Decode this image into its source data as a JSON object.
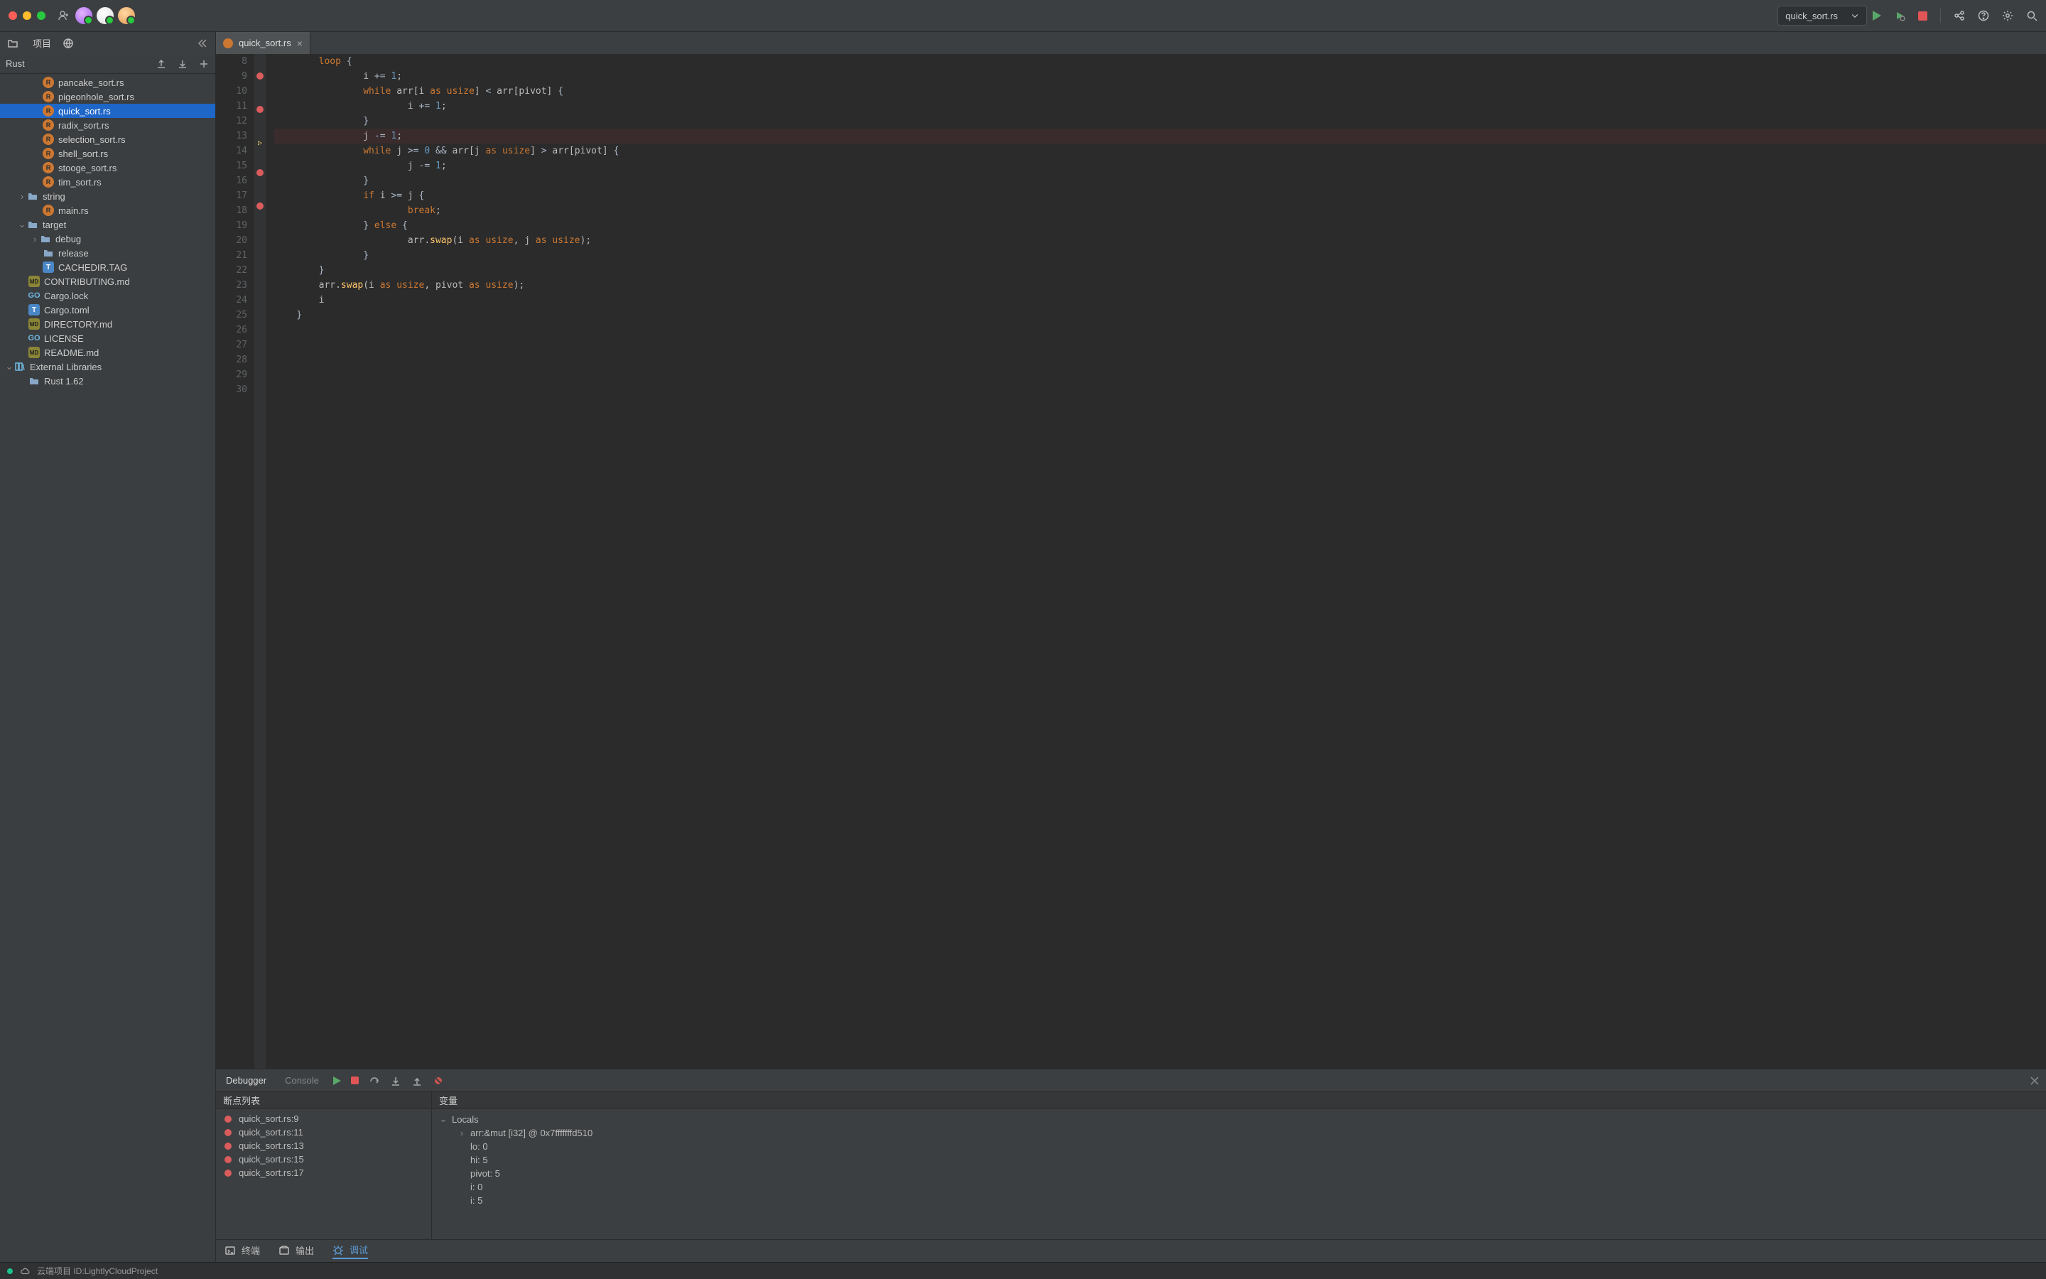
{
  "titlebar": {
    "run_config": "quick_sort.rs"
  },
  "secondbar": {
    "project_label": "项目"
  },
  "sidebar": {
    "root_label": "Rust",
    "items": [
      {
        "indent": 60,
        "icon": "rs",
        "label": "pancake_sort.rs",
        "sel": false
      },
      {
        "indent": 60,
        "icon": "rs",
        "label": "pigeonhole_sort.rs",
        "sel": false
      },
      {
        "indent": 60,
        "icon": "rs",
        "label": "quick_sort.rs",
        "sel": true
      },
      {
        "indent": 60,
        "icon": "rs",
        "label": "radix_sort.rs",
        "sel": false
      },
      {
        "indent": 60,
        "icon": "rs",
        "label": "selection_sort.rs",
        "sel": false
      },
      {
        "indent": 60,
        "icon": "rs",
        "label": "shell_sort.rs",
        "sel": false
      },
      {
        "indent": 60,
        "icon": "rs",
        "label": "stooge_sort.rs",
        "sel": false
      },
      {
        "indent": 60,
        "icon": "rs",
        "label": "tim_sort.rs",
        "sel": false
      },
      {
        "indent": 24,
        "tw": "›",
        "icon": "dir",
        "label": "string",
        "sel": false
      },
      {
        "indent": 60,
        "icon": "rs",
        "label": "main.rs",
        "sel": false
      },
      {
        "indent": 24,
        "tw": "⌄",
        "icon": "dir",
        "label": "target",
        "sel": false
      },
      {
        "indent": 42,
        "tw": "›",
        "icon": "dir",
        "label": "debug",
        "sel": false
      },
      {
        "indent": 60,
        "icon": "dir",
        "label": "release",
        "sel": false
      },
      {
        "indent": 60,
        "icon": "txt",
        "label": "CACHEDIR.TAG",
        "sel": false
      },
      {
        "indent": 40,
        "icon": "md",
        "label": "CONTRIBUTING.md",
        "sel": false
      },
      {
        "indent": 40,
        "icon": "go",
        "label": "Cargo.lock",
        "sel": false
      },
      {
        "indent": 40,
        "icon": "txt",
        "label": "Cargo.toml",
        "sel": false
      },
      {
        "indent": 40,
        "icon": "md",
        "label": "DIRECTORY.md",
        "sel": false
      },
      {
        "indent": 40,
        "icon": "go",
        "label": "LICENSE",
        "sel": false
      },
      {
        "indent": 40,
        "icon": "md",
        "label": "README.md",
        "sel": false
      },
      {
        "indent": 6,
        "tw": "⌄",
        "icon": "lib",
        "label": "External Libraries",
        "sel": false
      },
      {
        "indent": 40,
        "icon": "dir",
        "label": "Rust 1.62",
        "sel": false
      }
    ]
  },
  "editor": {
    "tab_label": "quick_sort.rs",
    "lines": [
      {
        "n": 8,
        "bp": false,
        "cur": false,
        "html": "<span class='k'>loop</span> <span class='br'>{</span>"
      },
      {
        "n": 9,
        "bp": true,
        "cur": false,
        "html": "    i <span class='op'>+=</span> <span class='n'>1</span>;"
      },
      {
        "n": 10,
        "bp": false,
        "cur": false,
        "html": "    <span class='k'>while</span> arr[i <span class='k'>as</span> <span class='k'>usize</span>] <span class='op'>&lt;</span> arr[pivot] <span class='br'>{</span>"
      },
      {
        "n": 11,
        "bp": true,
        "cur": false,
        "html": "        i <span class='op'>+=</span> <span class='n'>1</span>;"
      },
      {
        "n": 12,
        "bp": false,
        "cur": false,
        "html": "    <span class='br'>}</span>"
      },
      {
        "n": 13,
        "bp": false,
        "cur": true,
        "html": "    j <span class='op'>-=</span> <span class='n'>1</span>;"
      },
      {
        "n": 14,
        "bp": false,
        "cur": false,
        "html": "    <span class='k'>while</span> j <span class='op'>&gt;=</span> <span class='n'>0</span> <span class='op'>&amp;&amp;</span> arr[j <span class='k'>as</span> <span class='k'>usize</span>] <span class='op'>&gt;</span> arr[pivot] <span class='br'>{</span>"
      },
      {
        "n": 15,
        "bp": true,
        "cur": false,
        "html": "        j <span class='op'>-=</span> <span class='n'>1</span>;"
      },
      {
        "n": 16,
        "bp": false,
        "cur": false,
        "html": "    <span class='br'>}</span>"
      },
      {
        "n": 17,
        "bp": true,
        "cur": false,
        "html": "    <span class='k'>if</span> i <span class='op'>&gt;=</span> j <span class='br'>{</span>"
      },
      {
        "n": 18,
        "bp": false,
        "cur": false,
        "html": "        <span class='k'>break</span>;"
      },
      {
        "n": 19,
        "bp": false,
        "cur": false,
        "html": "    <span class='br'>}</span> <span class='k'>else</span> <span class='br'>{</span>"
      },
      {
        "n": 20,
        "bp": false,
        "cur": false,
        "html": "        arr.<span class='fnc'>swap</span>(i <span class='k'>as</span> <span class='k'>usize</span>, j <span class='k'>as</span> <span class='k'>usize</span>);"
      },
      {
        "n": 21,
        "bp": false,
        "cur": false,
        "html": "    <span class='br'>}</span>"
      },
      {
        "n": 22,
        "bp": false,
        "cur": false,
        "html": "<span class='br'>}</span>"
      },
      {
        "n": 23,
        "bp": false,
        "cur": false,
        "html": "arr.<span class='fnc'>swap</span>(i <span class='k'>as</span> <span class='k'>usize</span>, pivot <span class='k'>as</span> <span class='k'>usize</span>);"
      },
      {
        "n": 24,
        "bp": false,
        "cur": false,
        "html": "i"
      },
      {
        "n": 25,
        "bp": false,
        "cur": false,
        "html": "<span class='br'>}</span>",
        "dedent": 1
      },
      {
        "n": 26,
        "bp": false,
        "cur": false,
        "html": ""
      },
      {
        "n": 27,
        "bp": false,
        "cur": false,
        "html": ""
      },
      {
        "n": 28,
        "bp": false,
        "cur": false,
        "html": ""
      },
      {
        "n": 29,
        "bp": false,
        "cur": false,
        "html": ""
      },
      {
        "n": 30,
        "bp": false,
        "cur": false,
        "html": ""
      }
    ],
    "base_indent": "            "
  },
  "debug": {
    "tabs": {
      "debugger": "Debugger",
      "console": "Console"
    },
    "bp_header": "断点列表",
    "var_header": "变量",
    "breakpoints": [
      "quick_sort.rs:9",
      "quick_sort.rs:11",
      "quick_sort.rs:13",
      "quick_sort.rs:15",
      "quick_sort.rs:17"
    ],
    "vars_root": "Locals",
    "vars": [
      {
        "indent": 1,
        "tw": "›",
        "text": "arr:&mut [i32] @ 0x7fffffffd510"
      },
      {
        "indent": 1,
        "tw": "",
        "text": "lo: 0"
      },
      {
        "indent": 1,
        "tw": "",
        "text": "hi: 5"
      },
      {
        "indent": 1,
        "tw": "",
        "text": "pivot: 5"
      },
      {
        "indent": 1,
        "tw": "",
        "text": "i: 0"
      },
      {
        "indent": 1,
        "tw": "",
        "text": "i: 5"
      }
    ]
  },
  "bottombar": {
    "terminal": "终端",
    "output": "输出",
    "debug": "调试"
  },
  "statusbar": {
    "text": "云端项目 ID:LightlyCloudProject"
  }
}
